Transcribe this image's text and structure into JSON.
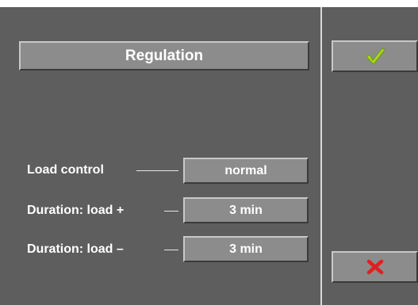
{
  "title": "Regulation",
  "rows": [
    {
      "label": "Load control",
      "value": "normal"
    },
    {
      "label": "Duration: load +",
      "value": "3 min"
    },
    {
      "label": "Duration: load –",
      "value": "3 min"
    }
  ],
  "buttons": {
    "confirm_icon": "checkmark-icon",
    "cancel_icon": "cross-icon"
  },
  "colors": {
    "panel": "#5e5e5e",
    "control": "#8c8c8c",
    "confirm": "#a8d81a",
    "cancel": "#e02020"
  }
}
